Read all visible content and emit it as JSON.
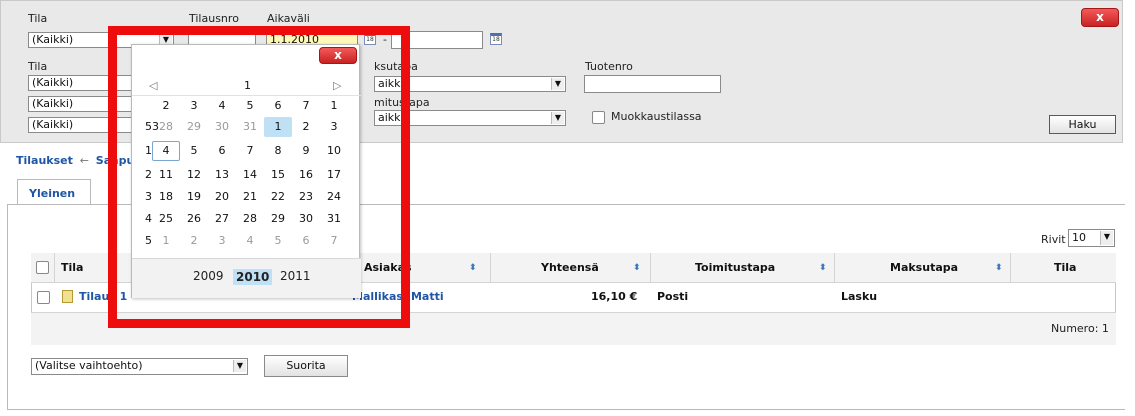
{
  "filters": {
    "row1": {
      "tila_label": "Tila",
      "tila_value": "(Kaikki)",
      "tilausnro_label": "Tilausnro",
      "aikavali_label": "Aikaväli",
      "date_from": "1.1.2010",
      "date_separator": "-",
      "date_to": ""
    },
    "row2": {
      "tila_label": "Tila",
      "selects": [
        "(Kaikki)",
        "(Kaikki)",
        "(Kaikki)"
      ],
      "maksutapa_label": "ksutapa",
      "maksutapa_value": "aikki)",
      "toimitustapa_label": "mitustapa",
      "toimitustapa_value": "aikki)",
      "tuotenro_label": "Tuotenro",
      "muokkaus_label": "Muokkaustilassa",
      "haku_label": "Haku"
    },
    "close_label": "x"
  },
  "breadcrumb": {
    "first": "Tilaukset",
    "separator": "←",
    "second": "Saapu"
  },
  "tabs": [
    {
      "label": "Yleinen"
    }
  ],
  "rows_selector": {
    "label": "Rivit",
    "value": "10"
  },
  "table": {
    "headers": {
      "tila": "Tila",
      "asiakas": "Asiakas",
      "yhteensa": "Yhteensä",
      "toimitustapa": "Toimitustapa",
      "maksutapa": "Maksutapa",
      "tila_last": "Tila"
    },
    "row": {
      "name": "Tilaus 1",
      "asiakas": "Mallikas, Matti",
      "yhteensa": "16,10 €",
      "toimitustapa": "Posti",
      "maksutapa": "Lasku"
    },
    "footer": "Numero: 1"
  },
  "actions": {
    "select_value": "(Valitse vaihtoehto)",
    "run_label": "Suorita"
  },
  "calendar": {
    "close_label": "x",
    "prev": "◁",
    "next": "▷",
    "month": "1",
    "weekday_row": [
      "2",
      "3",
      "4",
      "5",
      "6",
      "7",
      "1"
    ],
    "weeks": [
      {
        "num": "53",
        "days": [
          "28",
          "29",
          "30",
          "31",
          "1",
          "2",
          "3"
        ]
      },
      {
        "num": "1",
        "days": [
          "4",
          "5",
          "6",
          "7",
          "8",
          "9",
          "10"
        ]
      },
      {
        "num": "2",
        "days": [
          "11",
          "12",
          "13",
          "14",
          "15",
          "16",
          "17"
        ]
      },
      {
        "num": "3",
        "days": [
          "18",
          "19",
          "20",
          "21",
          "22",
          "23",
          "24"
        ]
      },
      {
        "num": "4",
        "days": [
          "25",
          "26",
          "27",
          "28",
          "29",
          "30",
          "31"
        ]
      },
      {
        "num": "5",
        "days": [
          "1",
          "2",
          "3",
          "4",
          "5",
          "6",
          "7"
        ]
      }
    ],
    "years": [
      "2009",
      "2010",
      "2011"
    ],
    "highlight_color": "#ee0d0d"
  }
}
